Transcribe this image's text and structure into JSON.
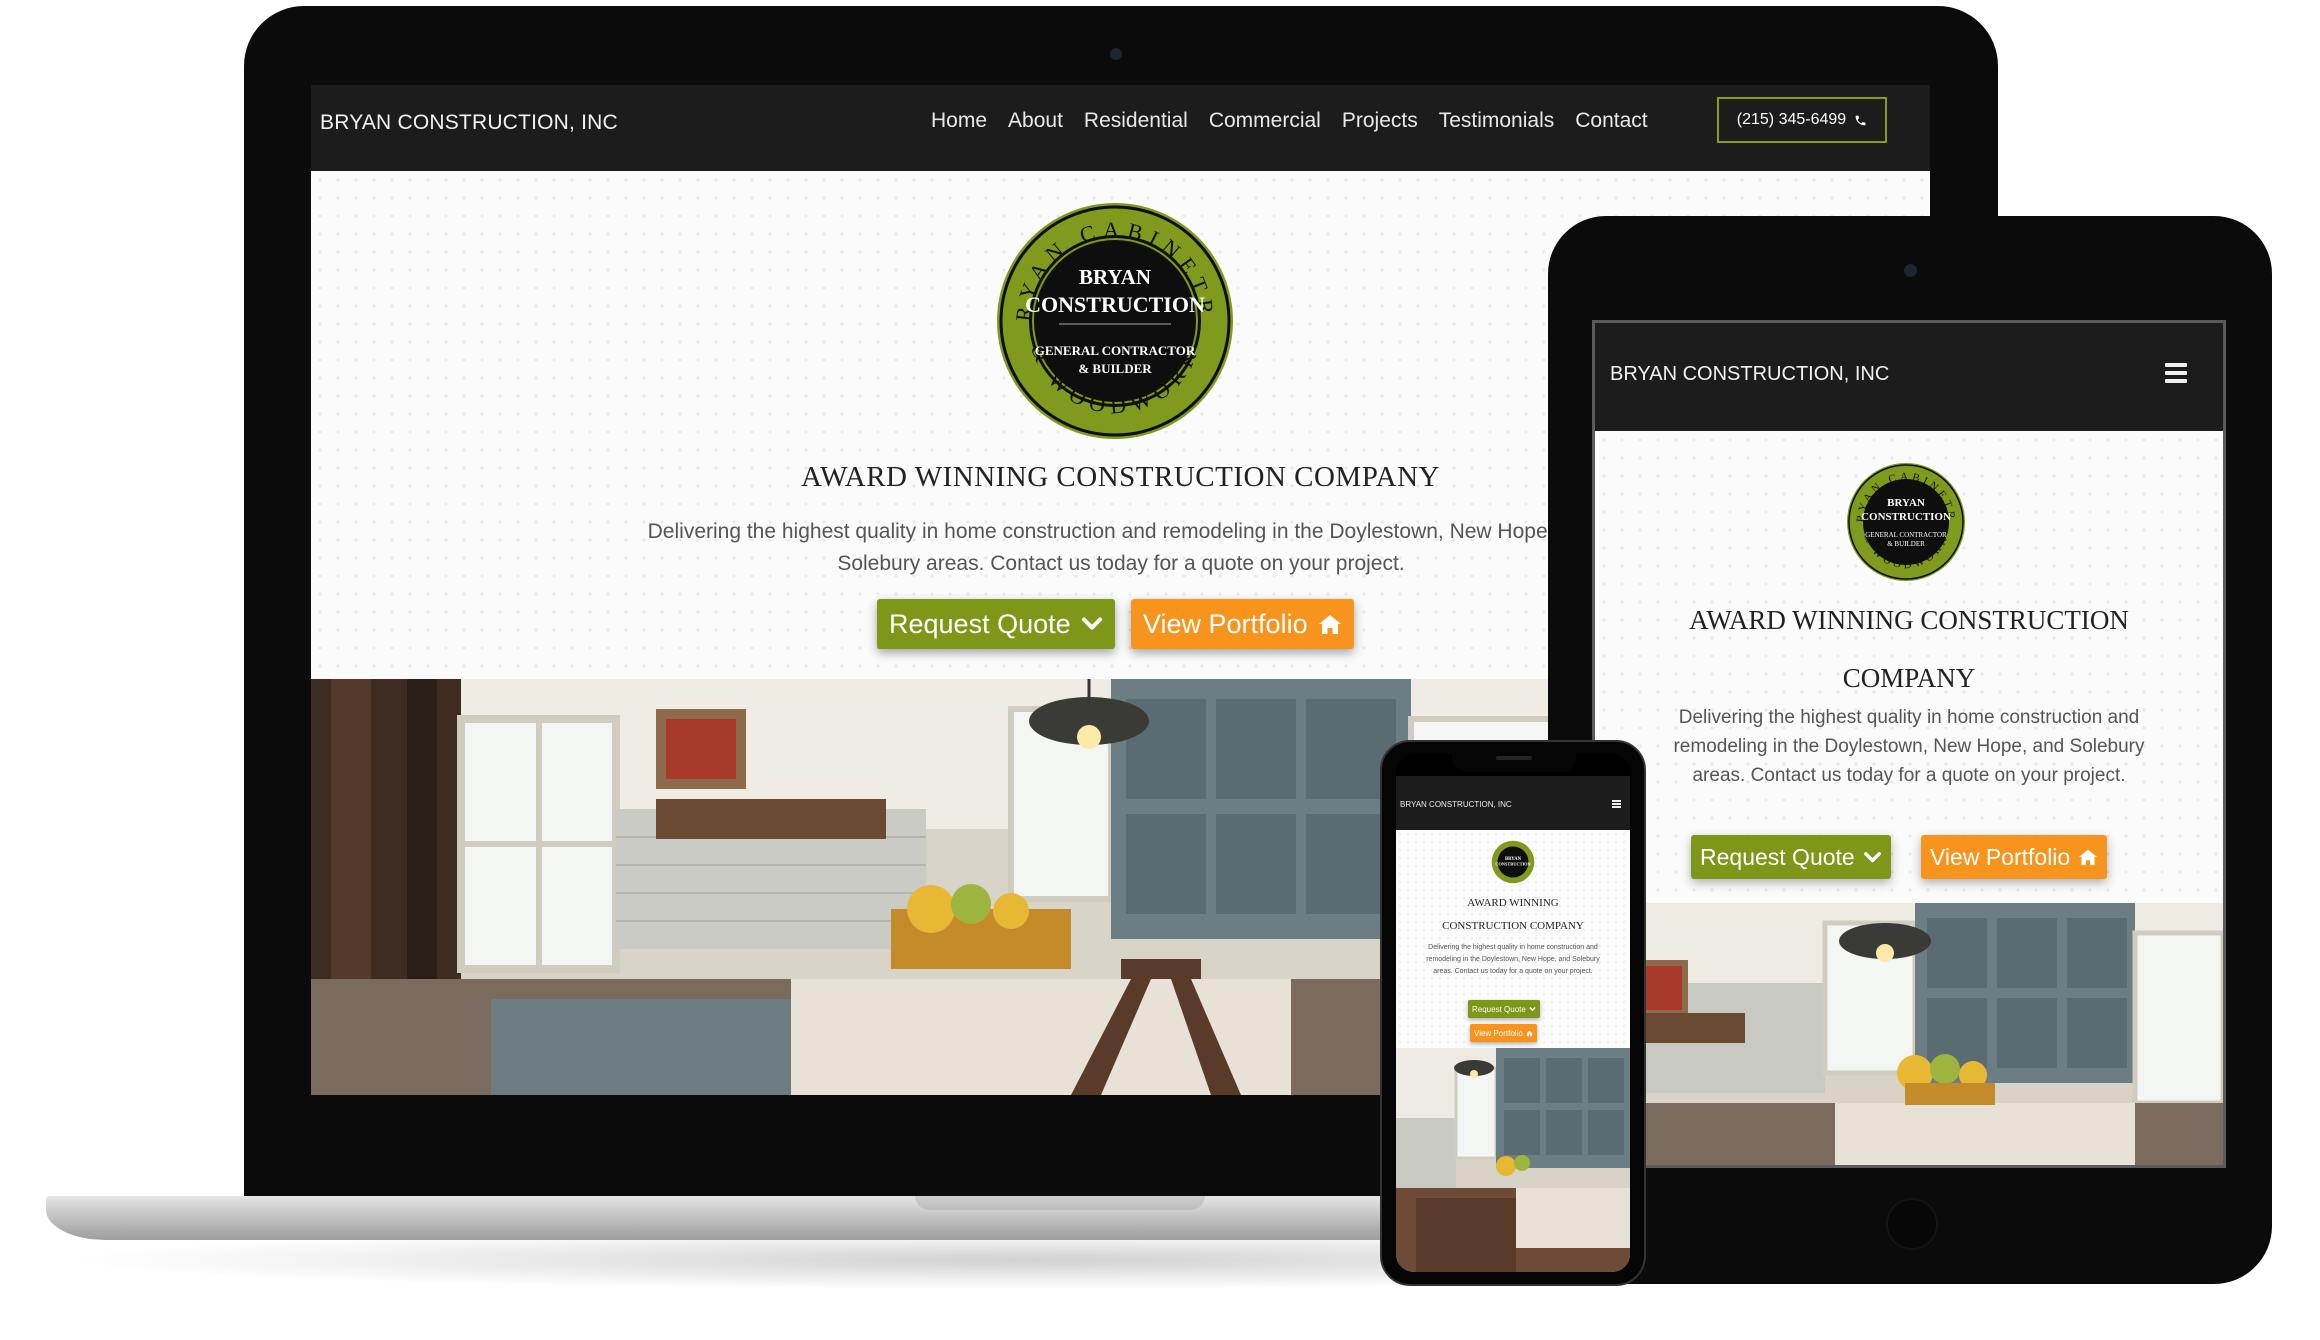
{
  "site": {
    "brand": "BRYAN CONSTRUCTION, INC",
    "nav": [
      "Home",
      "About",
      "Residential",
      "Commercial",
      "Projects",
      "Testimonials",
      "Contact"
    ],
    "phone": "(215) 345-6499",
    "headline": "AWARD WINNING CONSTRUCTION COMPANY",
    "headline_line1": "AWARD WINNING",
    "headline_line2": "CONSTRUCTION COMPANY",
    "headline_md_line1": "AWARD WINNING CONSTRUCTION",
    "headline_md_line2": "COMPANY",
    "description": "Delivering the highest quality in home construction and remodeling in the Doylestown, New Hope, and Solebury areas. Contact us today for a quote on your project.",
    "request_quote": "Request Quote",
    "view_portfolio": "View Portfolio"
  },
  "logo": {
    "ring_text": "BRYAN CABINETRY & WOODWORK",
    "line1": "BRYAN",
    "line2": "CONSTRUCTION",
    "line3": "GENERAL CONTRACTOR",
    "line4": "& BUILDER"
  },
  "colors": {
    "accent_green": "#7e9718",
    "accent_orange": "#f7941d",
    "nav_bg": "#1c1c1c"
  },
  "icons": {
    "quote": "chevron-down-icon",
    "portfolio": "home-icon",
    "phone": "phone-icon",
    "menu": "hamburger-menu-icon"
  }
}
